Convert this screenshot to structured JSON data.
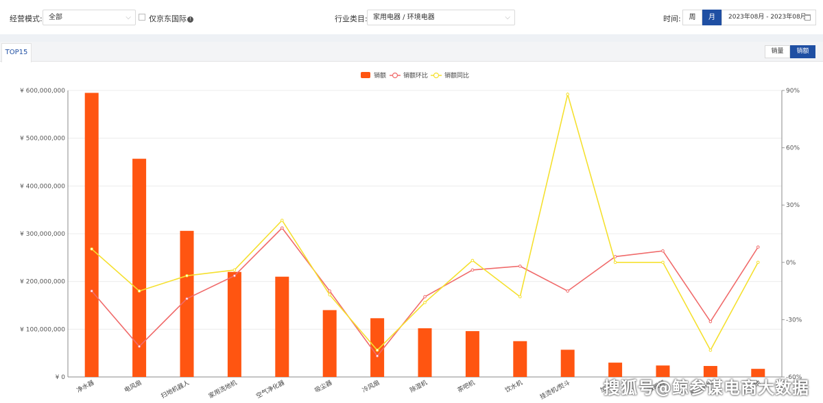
{
  "filters": {
    "mode_label": "经营模式:",
    "mode_value": "全部",
    "jd_intl_label": "仅京东国际",
    "industry_label": "行业类目:",
    "industry_value": "家用电器 / 环境电器",
    "time_label": "时间:",
    "period_week": "周",
    "period_month": "月",
    "period_active": "month",
    "date_range": "2023年08月 - 2023年08月"
  },
  "tab_label": "TOP15",
  "metric_toggle": {
    "qty": "销量",
    "amount": "销额",
    "active": "amount"
  },
  "chart_data": {
    "type": "bar",
    "legend": [
      "销额",
      "销额环比",
      "销额同比"
    ],
    "legend_position": "top-center",
    "categories": [
      "净水器",
      "电风扇",
      "扫地机器人",
      "家用洗地机",
      "空气净化器",
      "吸尘器",
      "冷风扇",
      "除湿机",
      "茶吧机",
      "饮水机",
      "挂烫机/熨斗",
      "加湿器",
      "取暖器",
      "新风系统",
      "其他"
    ],
    "series": [
      {
        "name": "销额",
        "type": "bar",
        "axis": "left",
        "color": "#ff5511",
        "values": [
          595000000,
          457000000,
          306000000,
          220000000,
          210000000,
          140000000,
          123000000,
          102000000,
          96000000,
          75000000,
          57000000,
          30000000,
          24000000,
          23000000,
          17000000
        ]
      },
      {
        "name": "销额环比",
        "type": "line",
        "axis": "right",
        "color": "#f06a6a",
        "values": [
          -15,
          -44,
          -19,
          -7,
          18,
          -15,
          -49,
          -18,
          -4,
          -2,
          -15,
          3,
          6,
          -31,
          8
        ]
      },
      {
        "name": "销额同比",
        "type": "line",
        "axis": "right",
        "color": "#f5e02e",
        "values": [
          7,
          -15,
          -7,
          -4,
          22,
          -17,
          -46,
          -21,
          1,
          -18,
          88,
          0,
          0,
          -46,
          0
        ]
      }
    ],
    "left_axis": {
      "min": 0,
      "max": 600000000,
      "ticks": [
        "¥ 0",
        "¥ 100,000,000",
        "¥ 200,000,000",
        "¥ 300,000,000",
        "¥ 400,000,000",
        "¥ 500,000,000",
        "¥ 600,000,000"
      ]
    },
    "right_axis": {
      "min": -60,
      "max": 90,
      "ticks": [
        "-60%",
        "-30%",
        "0%",
        "30%",
        "60%",
        "90%"
      ]
    },
    "grid": true
  },
  "watermark": "搜狐号@鲸参谋电商大数据",
  "colors": {
    "accent": "#1f4fa3",
    "bar": "#ff5511",
    "mom_line": "#f06a6a",
    "yoy_line": "#f5e02e"
  }
}
